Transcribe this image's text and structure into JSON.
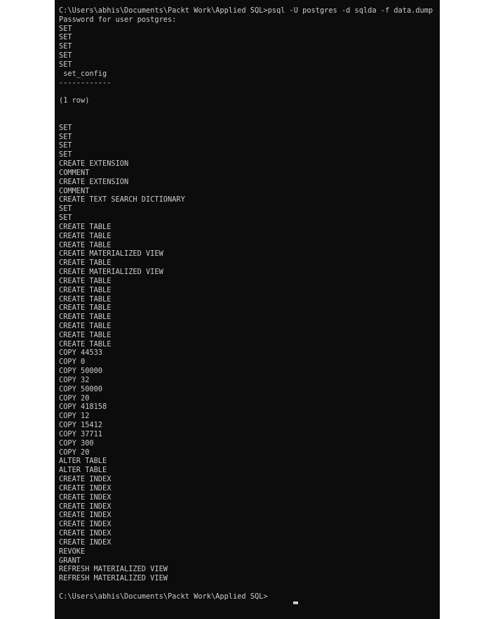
{
  "terminal": {
    "background_color": "#0c0c0c",
    "text_color": "#cccccc",
    "page_background_color": "#ffffff",
    "prompt_path": "C:\\Users\\abhis\\Documents\\Packt Work\\Applied SQL>",
    "command": "psql -U postgres -d sqlda -f data.dump",
    "password_prompt": "Password for user postgres:",
    "result_header": " set_config",
    "result_separator": "------------",
    "row_count": "(1 row)",
    "final_prompt": "C:\\Users\\abhis\\Documents\\Packt Work\\Applied SQL>",
    "cursor_glyph": "_",
    "lines": [
      "C:\\Users\\abhis\\Documents\\Packt Work\\Applied SQL>psql -U postgres -d sqlda -f data.dump",
      "Password for user postgres:",
      "SET",
      "SET",
      "SET",
      "SET",
      "SET",
      " set_config",
      "------------",
      "",
      "(1 row)",
      "",
      "",
      "SET",
      "SET",
      "SET",
      "SET",
      "CREATE EXTENSION",
      "COMMENT",
      "CREATE EXTENSION",
      "COMMENT",
      "CREATE TEXT SEARCH DICTIONARY",
      "SET",
      "SET",
      "CREATE TABLE",
      "CREATE TABLE",
      "CREATE TABLE",
      "CREATE MATERIALIZED VIEW",
      "CREATE TABLE",
      "CREATE MATERIALIZED VIEW",
      "CREATE TABLE",
      "CREATE TABLE",
      "CREATE TABLE",
      "CREATE TABLE",
      "CREATE TABLE",
      "CREATE TABLE",
      "CREATE TABLE",
      "CREATE TABLE",
      "COPY 44533",
      "COPY 0",
      "COPY 50000",
      "COPY 32",
      "COPY 50000",
      "COPY 20",
      "COPY 418158",
      "COPY 12",
      "COPY 15412",
      "COPY 37711",
      "COPY 300",
      "COPY 20",
      "ALTER TABLE",
      "ALTER TABLE",
      "CREATE INDEX",
      "CREATE INDEX",
      "CREATE INDEX",
      "CREATE INDEX",
      "CREATE INDEX",
      "CREATE INDEX",
      "CREATE INDEX",
      "CREATE INDEX",
      "REVOKE",
      "GRANT",
      "REFRESH MATERIALIZED VIEW",
      "REFRESH MATERIALIZED VIEW",
      "",
      "C:\\Users\\abhis\\Documents\\Packt Work\\Applied SQL>"
    ]
  }
}
